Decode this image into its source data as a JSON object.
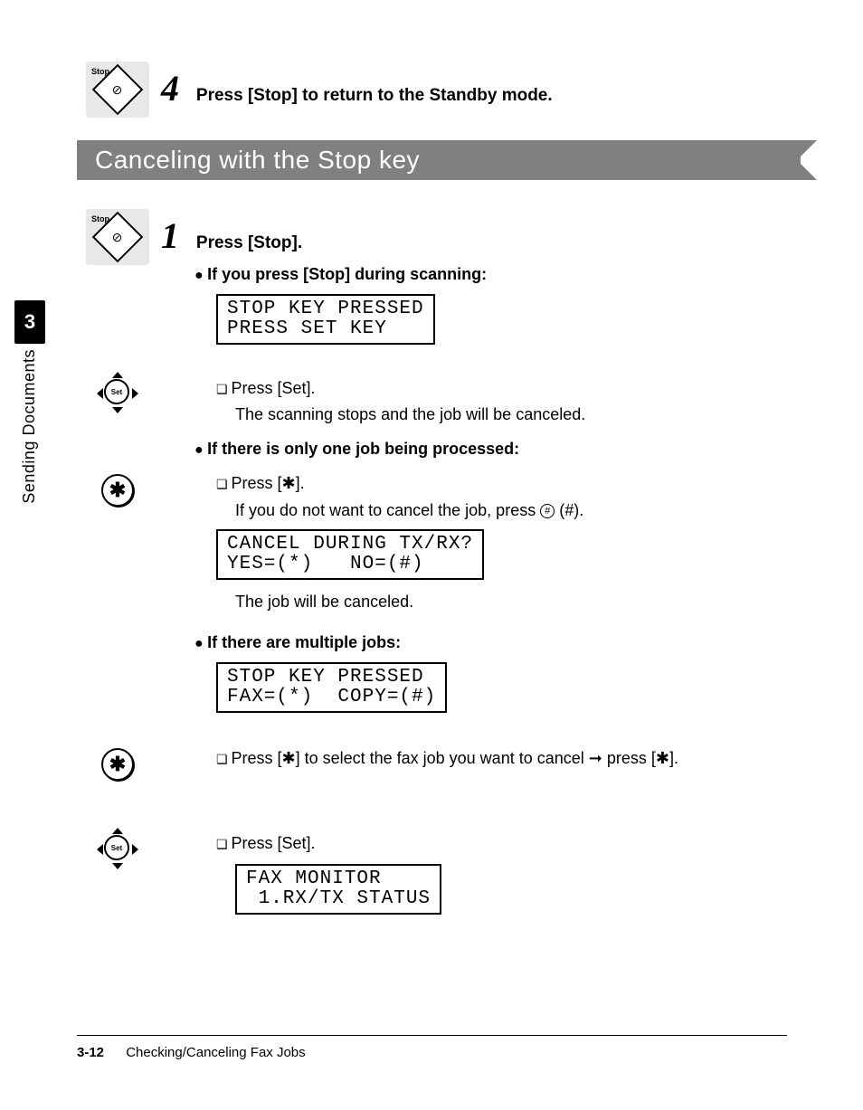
{
  "side_tab": {
    "chapter": "3",
    "label": "Sending Documents"
  },
  "step4": {
    "icon_label": "Stop",
    "num": "4",
    "text": "Press [Stop] to return to the Standby mode."
  },
  "section_title": "Canceling with the Stop key",
  "step1": {
    "icon_label": "Stop",
    "num": "1",
    "text": "Press [Stop].",
    "case_a": {
      "heading": "If you press [Stop] during scanning:",
      "lcd_line1": "STOP KEY PRESSED",
      "lcd_line2": "PRESS SET KEY",
      "sub1_label": "Press [Set].",
      "sub1_desc": "The scanning stops and the job will be canceled."
    },
    "case_b": {
      "heading": "If there is only one job being processed:",
      "sub1_label_pre": "Press [",
      "sub1_label_post": "].",
      "sub1_desc_pre": "If you do not want to cancel the job, press ",
      "sub1_desc_post": " (#).",
      "lcd_line1": "CANCEL DURING TX/RX?",
      "lcd_line2": "YES=(*)   NO=(#)",
      "result": "The job will be canceled."
    },
    "case_c": {
      "heading": "If there are multiple jobs:",
      "lcd_line1": "STOP KEY PRESSED",
      "lcd_line2": "FAX=(*)  COPY=(#)",
      "sub1_pre": "Press [",
      "sub1_mid": "] to select the fax job you want to cancel ",
      "sub1_post": " press [",
      "sub1_end": "].",
      "sub2_label": "Press [Set].",
      "lcd2_line1": "FAX MONITOR",
      "lcd2_line2": " 1.RX/TX STATUS"
    }
  },
  "footer": {
    "page": "3-12",
    "title": "Checking/Canceling Fax Jobs"
  },
  "glyphs": {
    "star": "✱",
    "arrow_right": "➞"
  }
}
